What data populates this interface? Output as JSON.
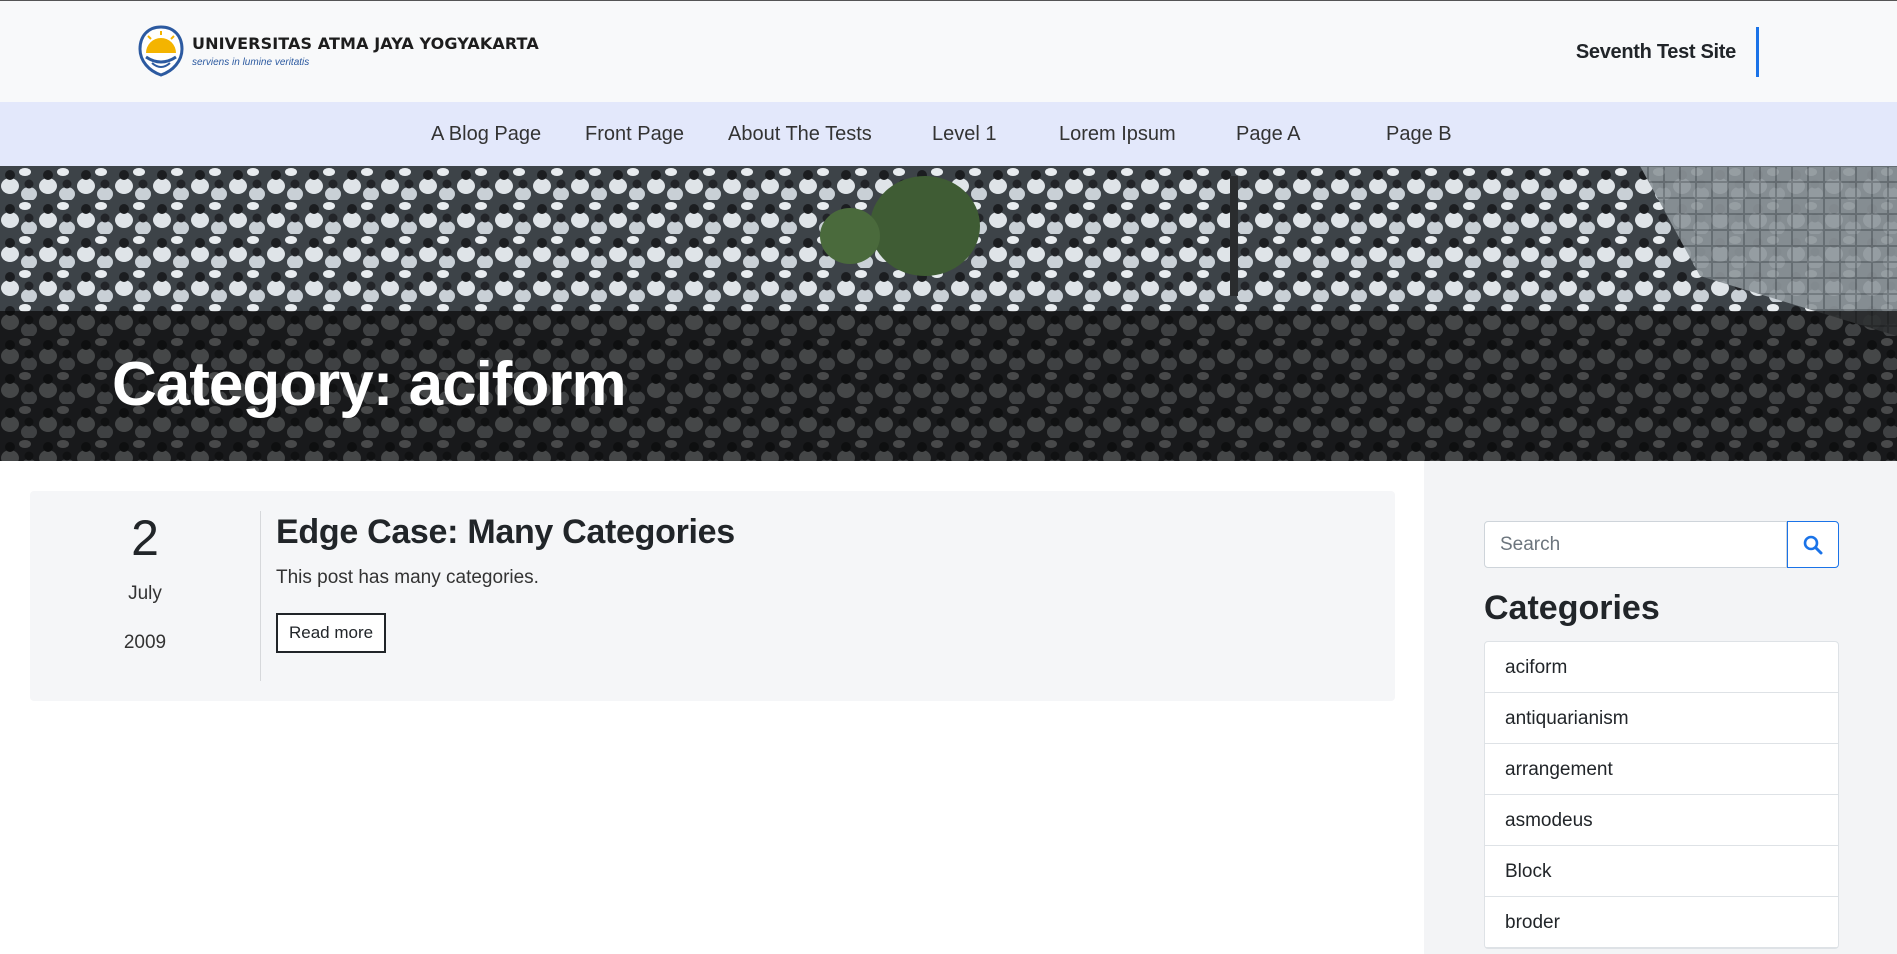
{
  "header": {
    "logo_title": "UNIVERSITAS ATMA JAYA YOGYAKARTA",
    "logo_subtitle": "serviens in lumine veritatis",
    "site_name": "Seventh Test Site"
  },
  "nav": {
    "items": [
      "A Blog Page",
      "Front Page",
      "About The Tests",
      "Level 1",
      "Lorem Ipsum",
      "Page A",
      "Page B"
    ]
  },
  "hero": {
    "title": "Category: aciform"
  },
  "post": {
    "day": "2",
    "month": "July",
    "year": "2009",
    "title": "Edge Case: Many Categories",
    "excerpt": "This post has many categories.",
    "read_more": "Read more"
  },
  "sidebar": {
    "search_placeholder": "Search",
    "search_icon": "search-icon",
    "categories_heading": "Categories",
    "categories": [
      "aciform",
      "antiquarianism",
      "arrangement",
      "asmodeus",
      "Block",
      "broder"
    ]
  },
  "colors": {
    "accent": "#1a73e8",
    "nav_bg": "#e3e8fb",
    "header_bg": "#f8f9fa"
  }
}
